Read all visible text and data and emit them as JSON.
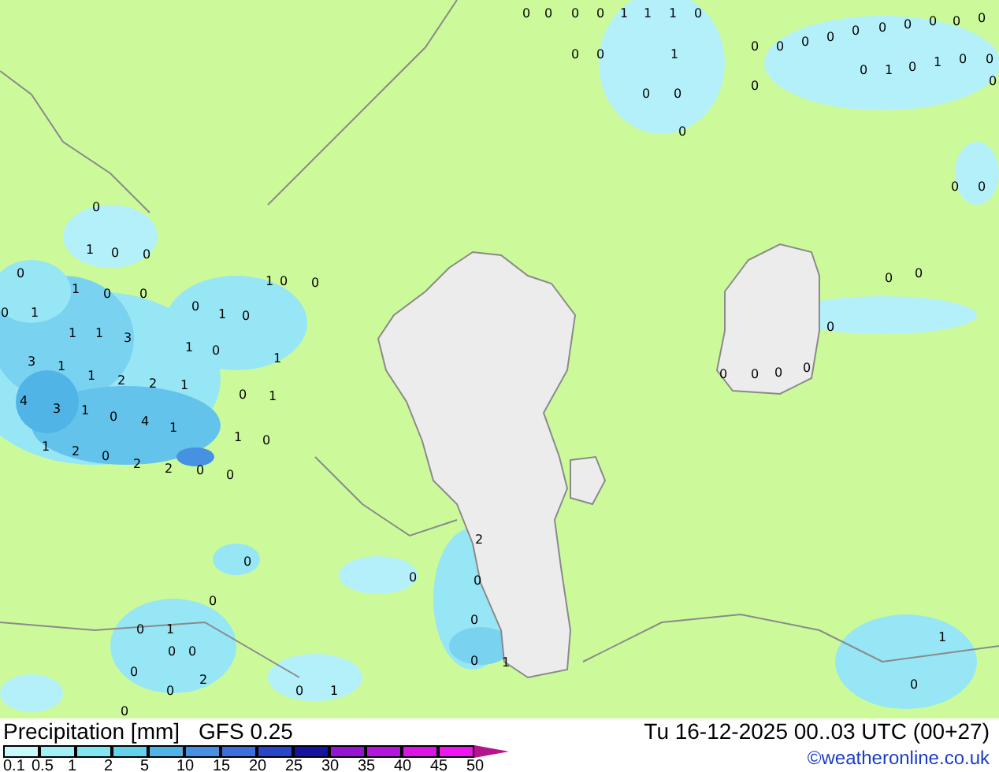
{
  "map": {
    "labels": [
      "0",
      "0",
      "0",
      "0",
      "1",
      "1",
      "1",
      "0",
      "0",
      "0",
      "1",
      "0",
      "0",
      "0",
      "0",
      "0",
      "0",
      "0",
      "0",
      "0",
      "0",
      "0",
      "0",
      "0",
      "0",
      "1",
      "0",
      "1",
      "0",
      "0",
      "0",
      "0",
      "0",
      "0",
      "0",
      "0",
      "0",
      "0",
      "0",
      "0",
      "0",
      "0",
      "1",
      "0",
      "0",
      "0",
      "1",
      "0",
      "0",
      "0",
      "1",
      "0",
      "1",
      "0",
      "0",
      "0",
      "1",
      "1",
      "1",
      "3",
      "1",
      "0",
      "1",
      "3",
      "1",
      "1",
      "2",
      "2",
      "1",
      "0",
      "1",
      "4",
      "3",
      "1",
      "0",
      "4",
      "1",
      "1",
      "0",
      "1",
      "2",
      "0",
      "2",
      "2",
      "0",
      "0",
      "0",
      "2",
      "0",
      "0",
      "0",
      "0",
      "0",
      "1",
      "0",
      "0",
      "0",
      "0",
      "2",
      "0",
      "1",
      "0",
      "1",
      "0",
      "1",
      "0"
    ]
  },
  "legend": {
    "title": "Precipitation [mm]",
    "model": "GFS 0.25",
    "swatches": [
      {
        "color": "#c8fafa"
      },
      {
        "color": "#a0f0f5"
      },
      {
        "color": "#82e6f0"
      },
      {
        "color": "#64d2eb"
      },
      {
        "color": "#50b4e6"
      },
      {
        "color": "#4691e1"
      },
      {
        "color": "#3c6edc"
      },
      {
        "color": "#2846c8"
      },
      {
        "color": "#1414a0"
      },
      {
        "color": "#9614d2"
      },
      {
        "color": "#b414dc"
      },
      {
        "color": "#dc14e6"
      },
      {
        "color": "#f014f0"
      },
      {
        "color": "#b4148c"
      }
    ],
    "ticks": [
      "0.1",
      "0.5",
      "1",
      "2",
      "5",
      "10",
      "15",
      "20",
      "25",
      "30",
      "35",
      "40",
      "45",
      "50"
    ]
  },
  "valid_time": "Tu 16-12-2025 00..03 UTC (00+27)",
  "credit": "©weatheronline.co.uk"
}
